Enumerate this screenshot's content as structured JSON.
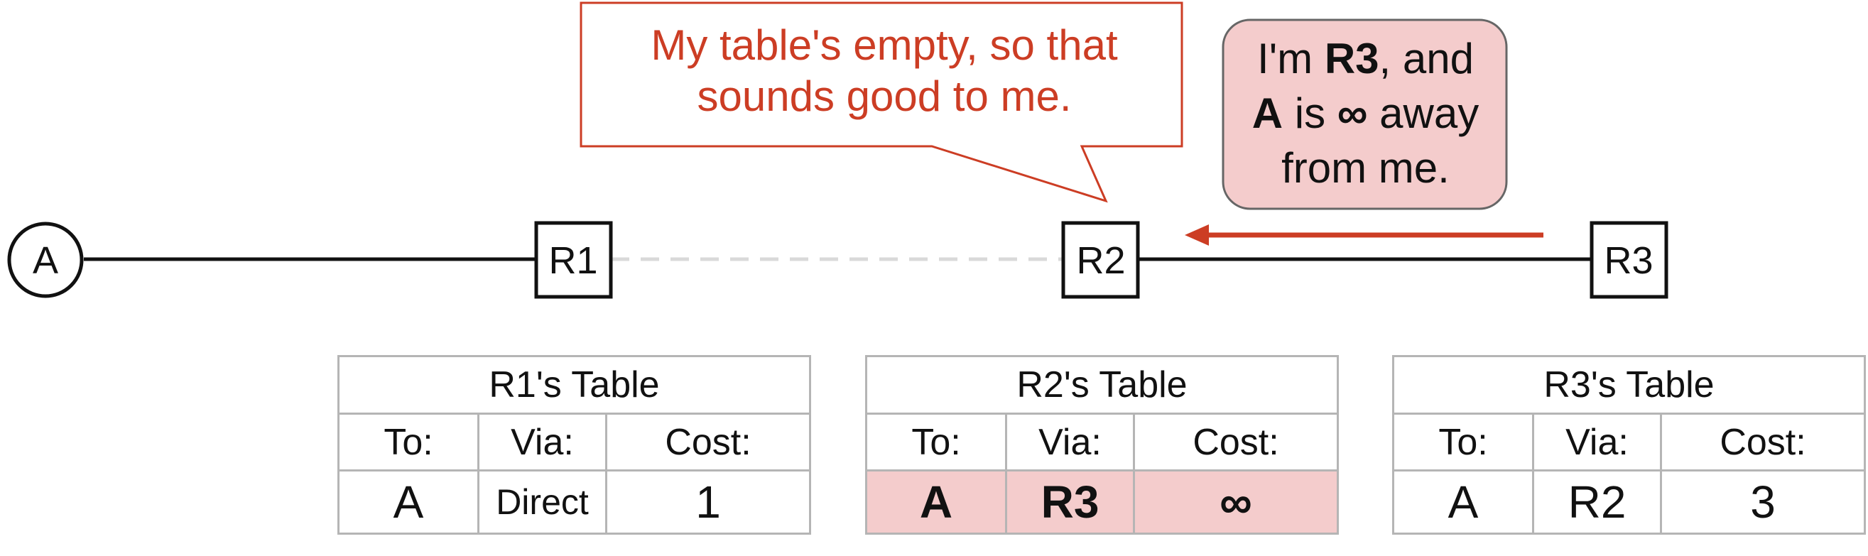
{
  "nodes": {
    "a": "A",
    "r1": "R1",
    "r2": "R2",
    "r3": "R3"
  },
  "bubble_r2": {
    "line1": "My table's empty, so that",
    "line2": "sounds good to me."
  },
  "bubble_r3": {
    "p1": "I'm ",
    "b1": "R3",
    "p2": ", and",
    "b2": "A",
    "p3": " is ",
    "b3": "∞",
    "p4": " away",
    "p5": "from me."
  },
  "tables": {
    "r1": {
      "title": "R1's Table",
      "to_h": "To:",
      "via_h": "Via:",
      "cost_h": "Cost:",
      "to": "A",
      "via": "Direct",
      "cost": "1"
    },
    "r2": {
      "title": "R2's Table",
      "to_h": "To:",
      "via_h": "Via:",
      "cost_h": "Cost:",
      "to": "A",
      "via": "R3",
      "cost": "∞"
    },
    "r3": {
      "title": "R3's Table",
      "to_h": "To:",
      "via_h": "Via:",
      "cost_h": "Cost:",
      "to": "A",
      "via": "R2",
      "cost": "3"
    }
  },
  "colors": {
    "accent_red": "#cc3d24",
    "highlight_pink": "#f4cccc",
    "dashed_link": "#d9d9d9"
  }
}
